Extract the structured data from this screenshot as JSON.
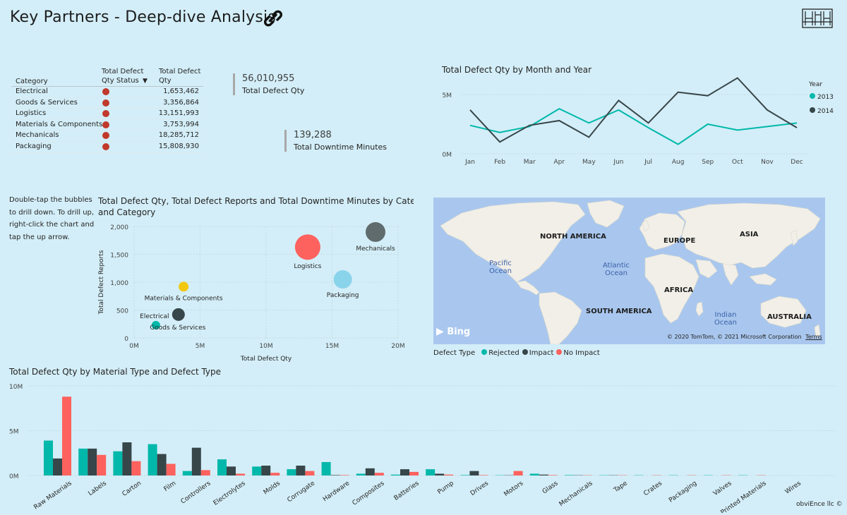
{
  "header": {
    "title": "Key Partners - Deep-dive Analysis",
    "footer": "obviEnce llc ©"
  },
  "table": {
    "col_category": "Category",
    "col_status_line1": "Total Defect",
    "col_status_line2": "Qty Status",
    "col_qty_line1": "Total Defect",
    "col_qty_line2": "Qty",
    "status_color": "#c0392b",
    "rows": [
      {
        "category": "Electrical",
        "qty": "1,653,462"
      },
      {
        "category": "Goods & Services",
        "qty": "3,356,864"
      },
      {
        "category": "Logistics",
        "qty": "13,151,993"
      },
      {
        "category": "Materials & Components",
        "qty": "3,753,994"
      },
      {
        "category": "Mechanicals",
        "qty": "18,285,712"
      },
      {
        "category": "Packaging",
        "qty": "15,808,930"
      }
    ]
  },
  "kpis": {
    "defect_value": "56,010,955",
    "defect_label": "Total Defect Qty",
    "downtime_value": "139,288",
    "downtime_label": "Total Downtime Minutes"
  },
  "hint": {
    "line1": "Double-tap the bubbles",
    "line2": "to drill down. To drill up,",
    "line3": "right-click the chart and",
    "line4": "tap the up arrow."
  },
  "map": {
    "labels": {
      "north_america": "NORTH AMERICA",
      "europe": "EUROPE",
      "asia": "ASIA",
      "africa": "AFRICA",
      "south_america": "SOUTH AMERICA",
      "australia": "AUSTRALIA",
      "pacific1": "Pacific",
      "pacific2": "Ocean",
      "atlantic1": "Atlantic",
      "atlantic2": "Ocean",
      "indian1": "Indian",
      "indian2": "Ocean"
    },
    "bing": "Bing",
    "attribution": "© 2020 TomTom, © 2021 Microsoft Corporation",
    "terms": "Terms",
    "legend_title": "Defect Type",
    "legend": [
      {
        "name": "Rejected",
        "color": "#01b8aa"
      },
      {
        "name": "Impact",
        "color": "#374649"
      },
      {
        "name": "No Impact",
        "color": "#fd625e"
      }
    ]
  },
  "chart_data": [
    {
      "type": "line",
      "title": "Total Defect Qty by Month and Year",
      "legend_title": "Year",
      "x": [
        "Jan",
        "Feb",
        "Mar",
        "Apr",
        "May",
        "Jun",
        "Jul",
        "Aug",
        "Sep",
        "Oct",
        "Nov",
        "Dec"
      ],
      "y_ticks": [
        "0M",
        "5M"
      ],
      "ylim": [
        0,
        5
      ],
      "series": [
        {
          "name": "2013",
          "color": "#01b8aa",
          "values": [
            2.4,
            1.8,
            2.3,
            3.8,
            2.6,
            3.7,
            2.2,
            0.8,
            2.5,
            2.0,
            2.3,
            2.6
          ]
        },
        {
          "name": "2014",
          "color": "#374649",
          "values": [
            3.7,
            1.0,
            2.4,
            2.8,
            1.4,
            4.5,
            2.6,
            5.2,
            4.9,
            6.4,
            3.7,
            2.2
          ]
        }
      ]
    },
    {
      "type": "scatter",
      "title_line1": "Total Defect Qty, Total Defect Reports and Total Downtime Minutes by Category",
      "title_line2": "and Category",
      "xlabel": "Total Defect Qty",
      "ylabel": "Total Defect Reports",
      "x_ticks": [
        "0M",
        "5M",
        "10M",
        "15M",
        "20M"
      ],
      "y_ticks": [
        "0",
        "500",
        "1,000",
        "1,500",
        "2,000"
      ],
      "xlim": [
        0,
        20
      ],
      "ylim": [
        0,
        2000
      ],
      "points": [
        {
          "label": "Electrical",
          "x": 1.65,
          "y": 230,
          "r": 6,
          "color": "#01b8aa"
        },
        {
          "label": "Goods & Services",
          "x": 3.36,
          "y": 420,
          "r": 9,
          "color": "#374649"
        },
        {
          "label": "Materials & Components",
          "x": 3.75,
          "y": 920,
          "r": 7,
          "color": "#f2c80f"
        },
        {
          "label": "Logistics",
          "x": 13.15,
          "y": 1630,
          "r": 18,
          "color": "#fd625e"
        },
        {
          "label": "Packaging",
          "x": 15.81,
          "y": 1050,
          "r": 13,
          "color": "#8ad4eb"
        },
        {
          "label": "Mechanicals",
          "x": 18.29,
          "y": 1900,
          "r": 14,
          "color": "#5f6b6d"
        }
      ]
    },
    {
      "type": "bar",
      "title": "Total Defect Qty by Material Type and Defect Type",
      "y_ticks": [
        "0M",
        "5M",
        "10M"
      ],
      "ylim": [
        0,
        10
      ],
      "categories": [
        "Raw Materials",
        "Labels",
        "Carton",
        "Film",
        "Controllers",
        "Electrolytes",
        "Molds",
        "Corrugate",
        "Hardware",
        "Composites",
        "Batteries",
        "Pump",
        "Drives",
        "Motors",
        "Glass",
        "Mechanicals",
        "Tape",
        "Crates",
        "Packaging",
        "Valves",
        "Printed Materials",
        "Wires"
      ],
      "series": [
        {
          "name": "Rejected",
          "color": "#01b8aa",
          "values": [
            3.9,
            3.0,
            2.7,
            3.5,
            0.5,
            1.8,
            1.0,
            0.7,
            1.5,
            0.2,
            0.1,
            0.7,
            0.05,
            0.03,
            0.2,
            0.05,
            0.03,
            0.03,
            0.03,
            0.03,
            0.03,
            0.0
          ]
        },
        {
          "name": "Impact",
          "color": "#374649",
          "values": [
            1.9,
            3.0,
            3.7,
            2.4,
            3.1,
            1.0,
            1.1,
            1.1,
            0.05,
            0.8,
            0.7,
            0.2,
            0.5,
            0.03,
            0.1,
            0.03,
            0.03,
            0.0,
            0.0,
            0.0,
            0.0,
            0.0
          ]
        },
        {
          "name": "No Impact",
          "color": "#fd625e",
          "values": [
            8.8,
            2.3,
            1.6,
            1.3,
            0.6,
            0.2,
            0.3,
            0.5,
            0.05,
            0.3,
            0.4,
            0.1,
            0.05,
            0.5,
            0.05,
            0.03,
            0.03,
            0.03,
            0.03,
            0.03,
            0.03,
            0.0
          ]
        }
      ]
    }
  ]
}
